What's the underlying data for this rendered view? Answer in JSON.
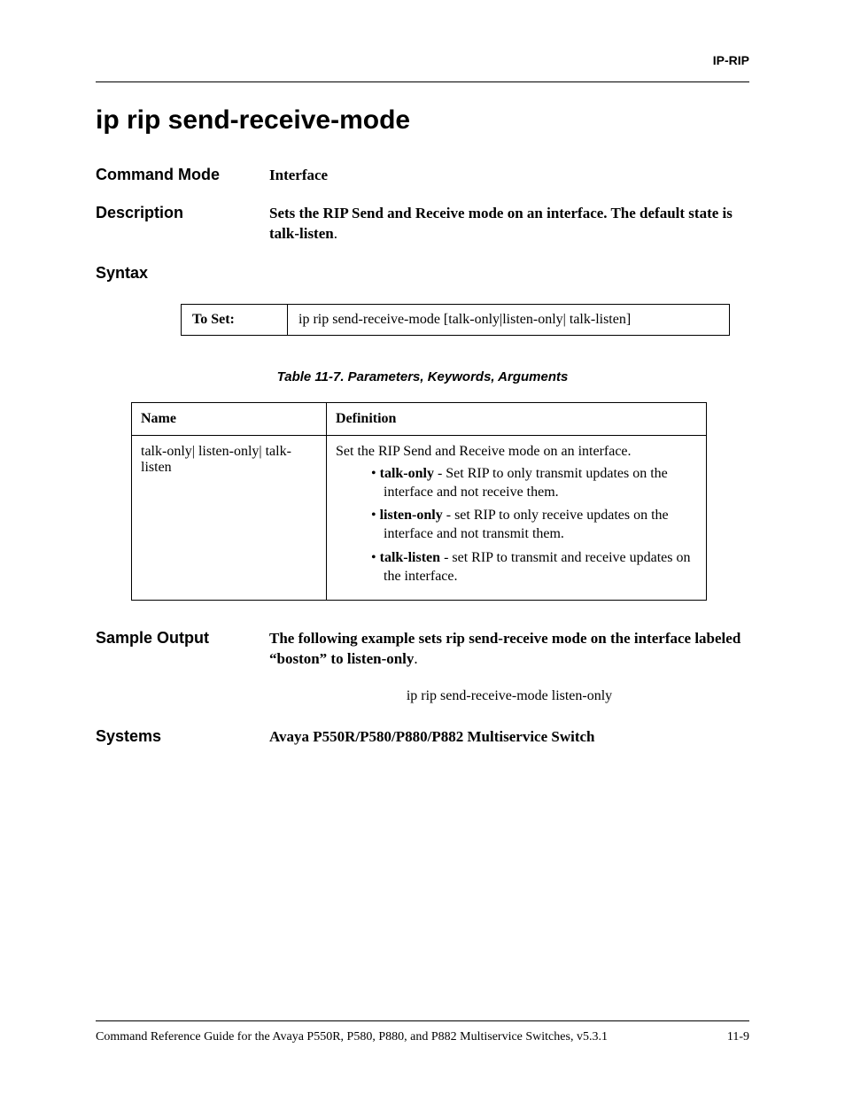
{
  "header": {
    "section_label": "IP-RIP"
  },
  "title": "ip rip send-receive-mode",
  "command_mode": {
    "label": "Command Mode",
    "value": "Interface"
  },
  "description": {
    "label": "Description",
    "text_bold": "Sets the RIP Send and Receive mode on an interface. The default state is talk-listen",
    "text_tail": "."
  },
  "syntax": {
    "label": "Syntax",
    "rows": [
      {
        "label": "To Set:",
        "command": "ip rip send-receive-mode [talk-only|listen-only| talk-listen]"
      }
    ]
  },
  "table_caption": "Table 11-7.  Parameters, Keywords, Arguments",
  "param_table": {
    "headers": {
      "name": "Name",
      "definition": "Definition"
    },
    "rows": [
      {
        "name": "talk-only| listen-only| talk-listen",
        "definition_intro": "Set the RIP Send and Receive mode on an interface.",
        "bullets": [
          {
            "bold": "talk-only",
            "rest": " - Set RIP to only transmit updates on the interface and not receive them."
          },
          {
            "bold": "listen-only",
            "rest": " - set RIP to only receive updates on the interface and not transmit them."
          },
          {
            "bold": "talk-listen",
            "rest": " - set RIP to transmit and receive updates on the interface."
          }
        ]
      }
    ]
  },
  "sample_output": {
    "label": "Sample Output",
    "text_bold": "The following example sets rip send-receive mode on the interface labeled “boston” to listen-only",
    "text_tail": ".",
    "code": "ip rip send-receive-mode listen-only"
  },
  "systems": {
    "label": "Systems",
    "value": "Avaya P550R/P580/P880/P882 Multiservice Switch"
  },
  "footer": {
    "left": "Command Reference Guide for the Avaya P550R, P580, P880, and P882 Multiservice Switches, v5.3.1",
    "right": "11-9"
  }
}
